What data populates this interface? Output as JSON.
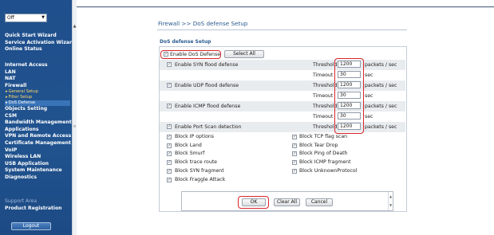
{
  "sidebar": {
    "mode_select": "Off",
    "group1": [
      "Quick Start Wizard",
      "Service Activation Wizard",
      "Online Status"
    ],
    "group2": [
      {
        "label": "Internet Access",
        "sub": false
      },
      {
        "label": "LAN",
        "sub": false
      },
      {
        "label": "NAT",
        "sub": false
      },
      {
        "label": "Firewall",
        "sub": false
      },
      {
        "label": "General Setup",
        "sub": true
      },
      {
        "label": "Filter Setup",
        "sub": true
      },
      {
        "label": "DoS Defense",
        "sub": true,
        "active": true
      },
      {
        "label": "Objects Setting",
        "sub": false
      },
      {
        "label": "CSM",
        "sub": false
      },
      {
        "label": "Bandwidth Management",
        "sub": false
      },
      {
        "label": "Applications",
        "sub": false
      },
      {
        "label": "VPN and Remote Access",
        "sub": false
      },
      {
        "label": "Certificate Management",
        "sub": false
      },
      {
        "label": "VoIP",
        "sub": false
      },
      {
        "label": "Wireless LAN",
        "sub": false
      },
      {
        "label": "USB Application",
        "sub": false
      },
      {
        "label": "System Maintenance",
        "sub": false
      },
      {
        "label": "Diagnostics",
        "sub": false
      }
    ],
    "group3": [
      "Support Area",
      "Product Registration"
    ],
    "logout": "Logout"
  },
  "main": {
    "breadcrumb": "Firewall >> DoS defense Setup",
    "section_title": "DoS defense Setup",
    "enable_dos_label": "Enable DoS Defense",
    "enable_dos_checked": true,
    "select_all": "Select All",
    "defense_rows": [
      {
        "name": "Enable SYN flood defense",
        "threshold_label": "Threshold",
        "threshold": "1200",
        "threshold_unit": "packets / sec",
        "timeout_label": "Timeout",
        "timeout": "30",
        "timeout_unit": "sec"
      },
      {
        "name": "Enable UDP flood defense",
        "threshold_label": "Threshold",
        "threshold": "1200",
        "threshold_unit": "packets / sec",
        "timeout_label": "Timeout",
        "timeout": "30",
        "timeout_unit": "sec"
      },
      {
        "name": "Enable ICMP flood defense",
        "threshold_label": "Threshold",
        "threshold": "1200",
        "threshold_unit": "packets / sec",
        "timeout_label": "Timeout",
        "timeout": "30",
        "timeout_unit": "sec"
      }
    ],
    "portscan": {
      "name": "Enable Port Scan detection",
      "threshold_label": "Threshold",
      "threshold": "1200",
      "threshold_unit": "packets / sec"
    },
    "block_left": [
      "Block IP options",
      "Block Land",
      "Block Smurf",
      "Block trace route",
      "Block SYN fragment",
      "Block Fraggle Attack"
    ],
    "block_right": [
      "Block TCP flag scan",
      "Block Tear Drop",
      "Block Ping of Death",
      "Block ICMP fragment",
      "Block UnknownProtocol"
    ],
    "buttons": {
      "ok": "OK",
      "clear_all": "Clear All",
      "cancel": "Cancel"
    },
    "highlight_color": "#d6262b",
    "accent_color": "#2b5a8f"
  }
}
